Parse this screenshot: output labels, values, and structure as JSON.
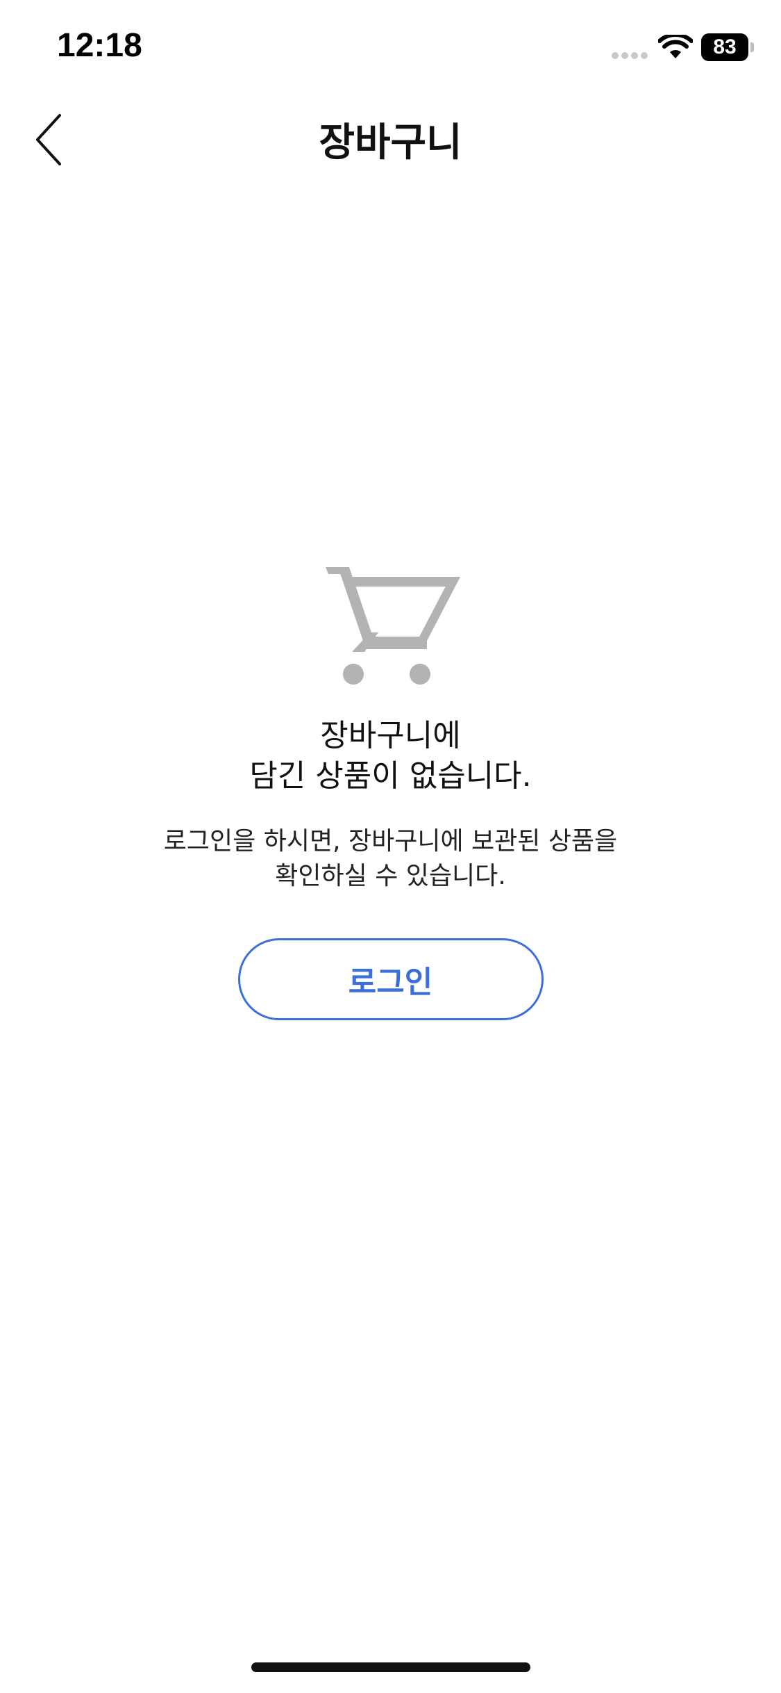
{
  "status_bar": {
    "time": "12:18",
    "battery": "83"
  },
  "nav": {
    "title": "장바구니",
    "back_icon": "chevron-left-icon"
  },
  "empty_state": {
    "icon": "cart-icon",
    "title_line1": "장바구니에",
    "title_line2": "담긴 상품이 없습니다.",
    "desc_line1": "로그인을 하시면, 장바구니에 보관된 상품을",
    "desc_line2": "확인하실 수 있습니다.",
    "login_label": "로그인"
  },
  "colors": {
    "accent": "#3a6fdc",
    "icon_gray": "#b3b3b3",
    "text": "#111111",
    "background": "#ffffff"
  }
}
